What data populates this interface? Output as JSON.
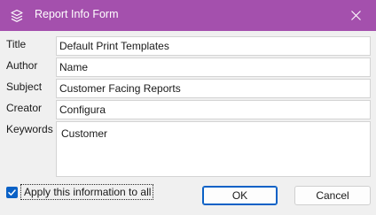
{
  "window": {
    "title": "Report Info Form",
    "accent_color": "#a450ad",
    "icon": "layers-icon",
    "close_icon": "close-icon"
  },
  "form": {
    "fields": [
      {
        "label": "Title",
        "value": "Default Print Templates"
      },
      {
        "label": "Author",
        "value": "Name"
      },
      {
        "label": "Subject",
        "value": "Customer Facing Reports"
      },
      {
        "label": "Creator",
        "value": "Configura"
      },
      {
        "label": "Keywords",
        "value": "Customer"
      }
    ],
    "apply_all": {
      "label": "Apply this information to all",
      "checked": true
    }
  },
  "buttons": {
    "ok": "OK",
    "cancel": "Cancel"
  }
}
